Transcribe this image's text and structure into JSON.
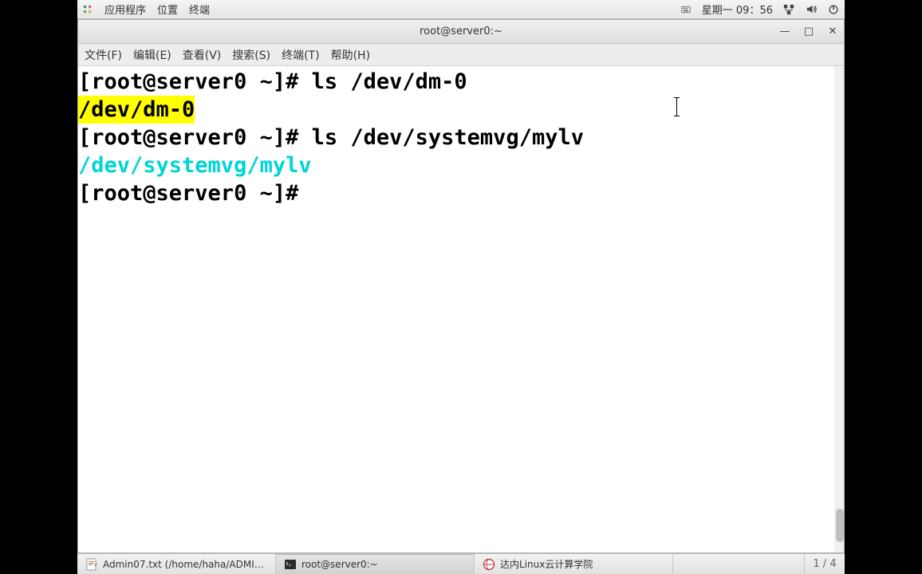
{
  "topbar": {
    "menus": [
      "应用程序",
      "位置",
      "终端"
    ],
    "datetime": "星期一 09：56"
  },
  "window": {
    "title": "root@server0:~",
    "controls": {
      "min": "—",
      "max": "□",
      "close": "✕"
    }
  },
  "menubar": {
    "file": "文件(F)",
    "edit": "编辑(E)",
    "view": "查看(V)",
    "search": "搜索(S)",
    "terminal": "终端(T)",
    "help": "帮助(H)"
  },
  "terminal": {
    "line1_prompt": "[root@server0 ~]# ",
    "line1_cmd": "ls /dev/dm-0",
    "line2_output": "/dev/dm-0",
    "line3_prompt": "[root@server0 ~]# ",
    "line3_cmd": "ls /dev/systemvg/mylv",
    "line4_output": "/dev/systemvg/mylv",
    "line5_prompt": "[root@server0 ~]# "
  },
  "taskbar": {
    "item1": "Admin07.txt (/home/haha/ADMIN/D…",
    "item2": "root@server0:~",
    "item3": "达内Linux云计算学院",
    "workspace": "1 / 4"
  }
}
